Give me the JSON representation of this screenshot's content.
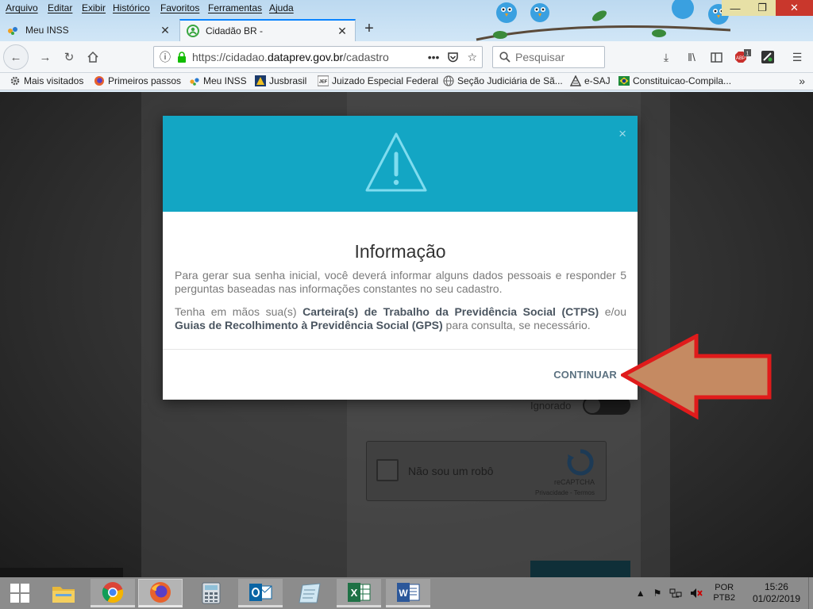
{
  "menu": [
    "Arquivo",
    "Editar",
    "Exibir",
    "Histórico",
    "Favoritos",
    "Ferramentas",
    "Ajuda"
  ],
  "tabs": [
    {
      "label": "Meu INSS",
      "active": false
    },
    {
      "label": "Cidadão BR -",
      "active": true
    }
  ],
  "address": {
    "prefix": "https://cidadao.",
    "domain": "dataprev.gov.br",
    "path": "/cadastro"
  },
  "search": {
    "placeholder": "Pesquisar"
  },
  "toolbar": {
    "notification_badge": "1"
  },
  "bookmarks": [
    "Mais visitados",
    "Primeiros passos",
    "Meu INSS",
    "Jusbrasil",
    "Juizado Especial Federal",
    "Seção Judiciária de Sã...",
    "e-SAJ",
    "Constituicao-Compila..."
  ],
  "page": {
    "toggle_label": "Ignorado",
    "recaptcha_label": "Não sou um robô",
    "recaptcha_brand": "reCAPTCHA",
    "recaptcha_terms": "Privacidade - Termos"
  },
  "modal": {
    "title": "Informação",
    "paragraph1": "Para gerar sua senha inicial, você deverá informar alguns dados pessoais e responder 5 perguntas baseadas nas informações constantes no seu cadastro.",
    "p2_intro": "Tenha em mãos sua(s) ",
    "p2_bold1": "Carteira(s) de Trabalho da Previdência Social (CTPS)",
    "p2_mid": " e/ou ",
    "p2_bold2": "Guias de Recolhimento à Previdência Social (GPS)",
    "p2_end": " para consulta, se necessário.",
    "close": "×",
    "continue_label": "CONTINUAR"
  },
  "colors": {
    "modal_header": "#13a6c4",
    "arrow_fill": "#c58a62",
    "arrow_stroke": "#e01b1b"
  },
  "taskbar": {
    "language_top": "POR",
    "language_bottom": "PTB2",
    "time": "15:26",
    "date": "01/02/2019",
    "apps": [
      "file-explorer",
      "chrome",
      "firefox",
      "calculator",
      "outlook",
      "notepad",
      "excel",
      "word"
    ]
  }
}
